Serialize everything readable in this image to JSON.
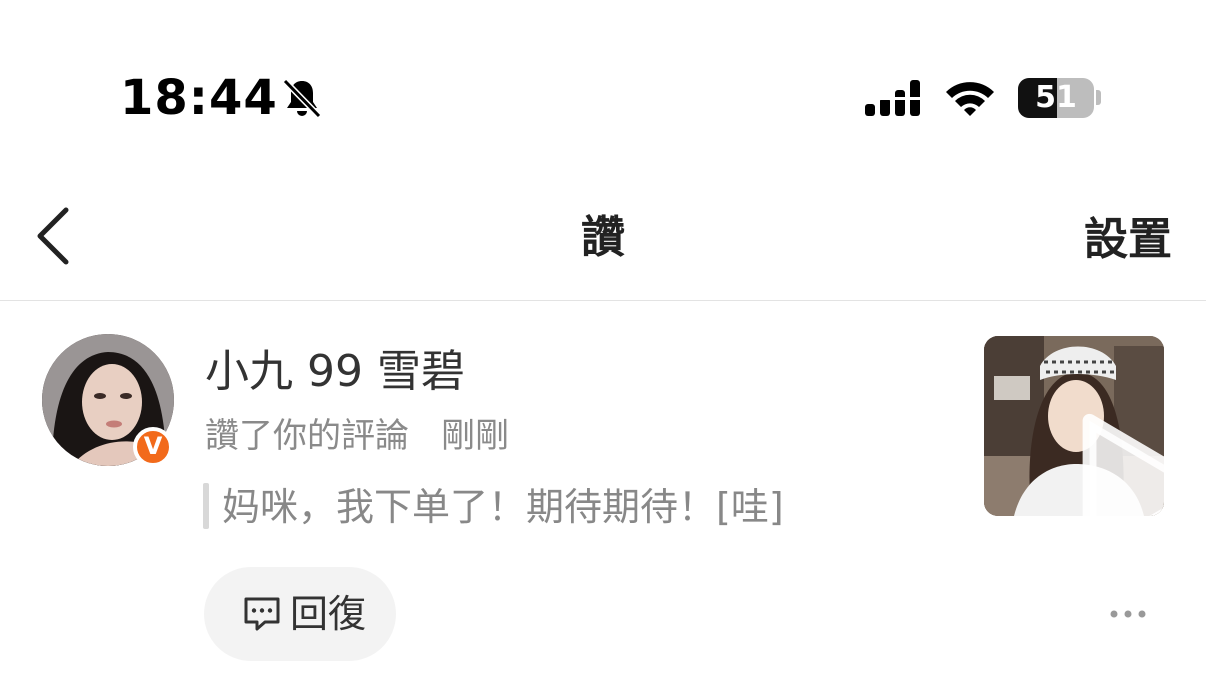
{
  "status_bar": {
    "time": "18:44",
    "battery_percent": "51",
    "icons": [
      "bell-slash-icon",
      "cellular-signal-icon",
      "wifi-icon",
      "battery-icon"
    ]
  },
  "nav": {
    "back_icon": "chevron-left-icon",
    "title": "讚",
    "settings_label": "設置"
  },
  "notification": {
    "username": "小九 99 雪碧",
    "badge": "V",
    "action": "讚了你的評論",
    "time": "剛剛",
    "comment": "妈咪，我下单了！期待期待！[哇]",
    "reply_label": "回復",
    "reply_icon": "comment-icon",
    "more_icon": "more-dots-icon",
    "thumbnail_icon": "play-icon"
  },
  "colors": {
    "badge": "#f26a1b",
    "reply_bg": "#f3f3f3",
    "divider": "#e3e3e3"
  }
}
